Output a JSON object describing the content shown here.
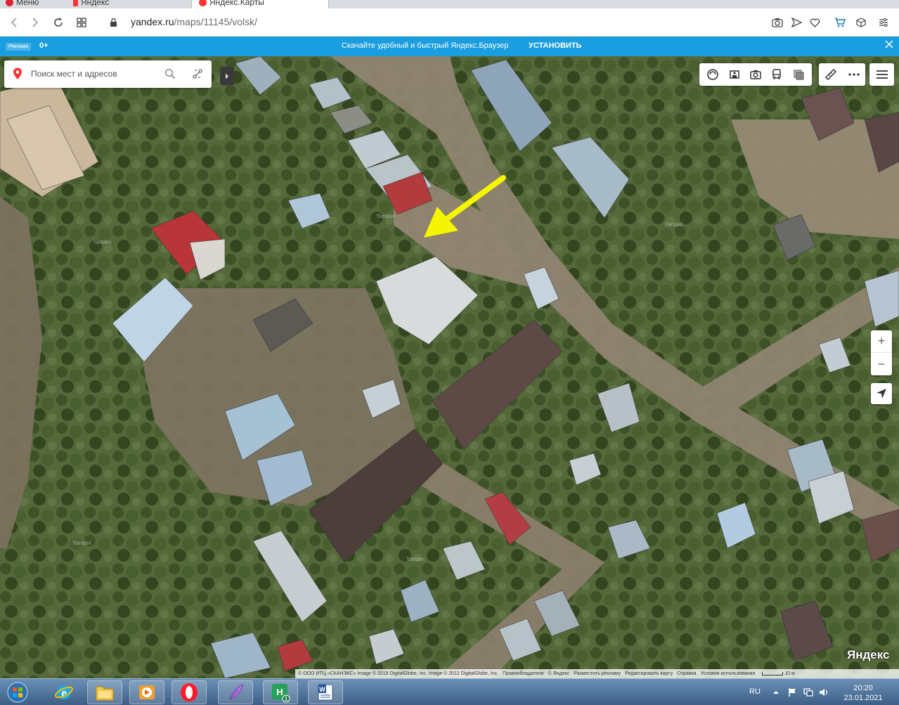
{
  "browser": {
    "tabs": [
      {
        "label": "Меню",
        "icon": "opera-icon",
        "active": false
      },
      {
        "label": "Яндекс",
        "icon": "yandex-icon",
        "active": false
      },
      {
        "label": "Яндекс.Карты",
        "icon": "yandex-maps-icon",
        "active": true
      }
    ],
    "address": {
      "host": "yandex.ru",
      "path": "/maps/11145/volsk/"
    }
  },
  "banner": {
    "ad_badge": "Реклама",
    "age": "0+",
    "text": "Скачайте удобный и быстрый Яндекс.Браузер",
    "install_label": "УСТАНОВИТЬ",
    "color": "#1a9ee0"
  },
  "map": {
    "search_placeholder": "Поиск мест и адресов",
    "brand": "Яндекс",
    "watermarks": [
      "Yandex",
      "Yandex",
      "Yandex",
      "Yandex",
      "Yandex"
    ],
    "layer_controls": [
      "traffic-icon",
      "panorama-icon",
      "camera-icon",
      "transit-icon",
      "layers-icon"
    ],
    "tool_controls": [
      "ruler-icon",
      "more-icon"
    ],
    "zoom_in_label": "+",
    "zoom_out_label": "−",
    "arrow_color": "#f5f500"
  },
  "copyright": {
    "imagery": "© ООО ИТЦ «СКАНЭКС» Image © 2019 DigitalGlobe, Inc. Image © 2012 DigitalGlobe, Inc.",
    "rights_holders": "Правообладатели",
    "yandex": "© Яндекс",
    "advertise": "Разместить рекламу",
    "edit_map": "Редактировать карту",
    "help": "Справка",
    "terms": "Условия использования",
    "scale": "10 м"
  },
  "taskbar": {
    "apps": [
      "ie-icon",
      "explorer-icon",
      "media-player-icon",
      "opera-icon",
      "feather-app-icon",
      "excel-app-icon",
      "word-icon"
    ],
    "badge": "1",
    "language": "RU",
    "time": "20:20",
    "date": "23.01.2021"
  }
}
